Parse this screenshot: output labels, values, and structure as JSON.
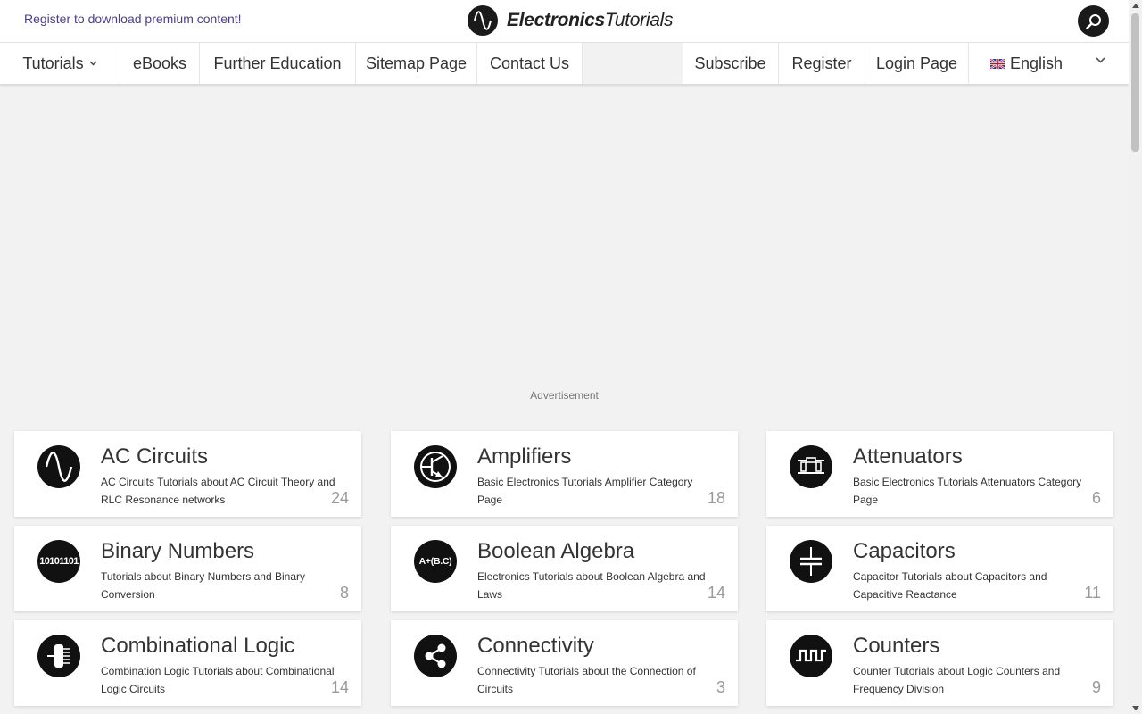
{
  "topbar": {
    "register_text": "Register to download premium content!",
    "logo_bold": "Electronics",
    "logo_light": "Tutorials",
    "search_icon": "search-icon"
  },
  "nav": {
    "tutorials": "Tutorials",
    "ebooks": "eBooks",
    "further_education": "Further Education",
    "sitemap": "Sitemap Page",
    "contact": "Contact Us",
    "subscribe": "Subscribe",
    "register": "Register",
    "login": "Login Page",
    "language": "English"
  },
  "ad": {
    "label": "Advertisement"
  },
  "cards": [
    {
      "title": "AC Circuits",
      "desc": "AC Circuits Tutorials about AC Circuit Theory and RLC Resonance networks",
      "count": "24",
      "icon": "sine-wave-icon"
    },
    {
      "title": "Amplifiers",
      "desc": "Basic Electronics Tutorials Amplifier Category Page",
      "count": "18",
      "icon": "transistor-icon"
    },
    {
      "title": "Attenuators",
      "desc": "Basic Electronics Tutorials Attenuators Category Page",
      "count": "6",
      "icon": "attenuator-icon"
    },
    {
      "title": "Binary Numbers",
      "desc": "Tutorials about Binary Numbers and Binary Conversion",
      "count": "8",
      "icon": "binary-icon",
      "icon_text": "10101101"
    },
    {
      "title": "Boolean Algebra",
      "desc": "Electronics Tutorials about Boolean Algebra and Laws",
      "count": "14",
      "icon": "boolean-icon",
      "icon_text": "A+(B.C)"
    },
    {
      "title": "Capacitors",
      "desc": "Capacitor Tutorials about Capacitors and Capacitive Reactance",
      "count": "11",
      "icon": "capacitor-icon"
    },
    {
      "title": "Combinational Logic",
      "desc": "Combination Logic Tutorials about Combinational Logic Circuits",
      "count": "14",
      "icon": "logic-chip-icon"
    },
    {
      "title": "Connectivity",
      "desc": "Connectivity Tutorials about the Connection of Circuits",
      "count": "3",
      "icon": "share-nodes-icon"
    },
    {
      "title": "Counters",
      "desc": "Counter Tutorials about Logic Counters and Frequency Division",
      "count": "9",
      "icon": "square-wave-icon"
    }
  ],
  "colors": {
    "accent_link": "#4a3f8a",
    "icon_bg": "#111111",
    "page_bg": "#f2f2f2",
    "count_text": "#999999"
  }
}
